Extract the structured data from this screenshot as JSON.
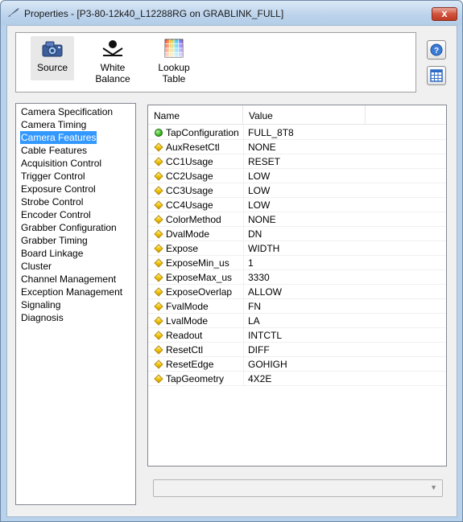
{
  "window": {
    "title": "Properties - [P3-80-12k40_L12288RG on GRABLINK_FULL]",
    "close_glyph": "x"
  },
  "toolbar": {
    "items": [
      {
        "label": "Source",
        "icon": "camera-icon",
        "selected": true
      },
      {
        "label": "White\nBalance",
        "icon": "white-balance-icon",
        "selected": false
      },
      {
        "label": "Lookup\nTable",
        "icon": "lookup-table-icon",
        "selected": false
      }
    ],
    "side_buttons": [
      {
        "icon": "help-icon"
      },
      {
        "icon": "table-view-icon"
      }
    ]
  },
  "categories": {
    "items": [
      "Camera Specification",
      "Camera Timing",
      "Camera Features",
      "Cable Features",
      "Acquisition Control",
      "Trigger Control",
      "Exposure Control",
      "Strobe Control",
      "Encoder Control",
      "Grabber Configuration",
      "Grabber Timing",
      "Board Linkage",
      "Cluster",
      "Channel Management",
      "Exception Management",
      "Signaling",
      "Diagnosis"
    ],
    "selected_index": 2
  },
  "properties": {
    "columns": {
      "name": "Name",
      "value": "Value"
    },
    "rows": [
      {
        "name": "TapConfiguration",
        "value": "FULL_8T8",
        "marker": "dot"
      },
      {
        "name": "AuxResetCtl",
        "value": "NONE",
        "marker": "diamond"
      },
      {
        "name": "CC1Usage",
        "value": "RESET",
        "marker": "diamond"
      },
      {
        "name": "CC2Usage",
        "value": "LOW",
        "marker": "diamond"
      },
      {
        "name": "CC3Usage",
        "value": "LOW",
        "marker": "diamond"
      },
      {
        "name": "CC4Usage",
        "value": "LOW",
        "marker": "diamond"
      },
      {
        "name": "ColorMethod",
        "value": "NONE",
        "marker": "diamond"
      },
      {
        "name": "DvalMode",
        "value": "DN",
        "marker": "diamond"
      },
      {
        "name": "Expose",
        "value": "WIDTH",
        "marker": "diamond"
      },
      {
        "name": "ExposeMin_us",
        "value": "1",
        "marker": "diamond"
      },
      {
        "name": "ExposeMax_us",
        "value": "3330",
        "marker": "diamond"
      },
      {
        "name": "ExposeOverlap",
        "value": "ALLOW",
        "marker": "diamond"
      },
      {
        "name": "FvalMode",
        "value": "FN",
        "marker": "diamond"
      },
      {
        "name": "LvalMode",
        "value": "LA",
        "marker": "diamond"
      },
      {
        "name": "Readout",
        "value": "INTCTL",
        "marker": "diamond"
      },
      {
        "name": "ResetCtl",
        "value": "DIFF",
        "marker": "diamond"
      },
      {
        "name": "ResetEdge",
        "value": "GOHIGH",
        "marker": "diamond"
      },
      {
        "name": "TapGeometry",
        "value": "4X2E",
        "marker": "diamond"
      }
    ]
  },
  "value_combo": {
    "value": ""
  },
  "colors": {
    "selection": "#3399ff",
    "status_ok": "#38b21e",
    "status_editable": "#f2c200"
  }
}
